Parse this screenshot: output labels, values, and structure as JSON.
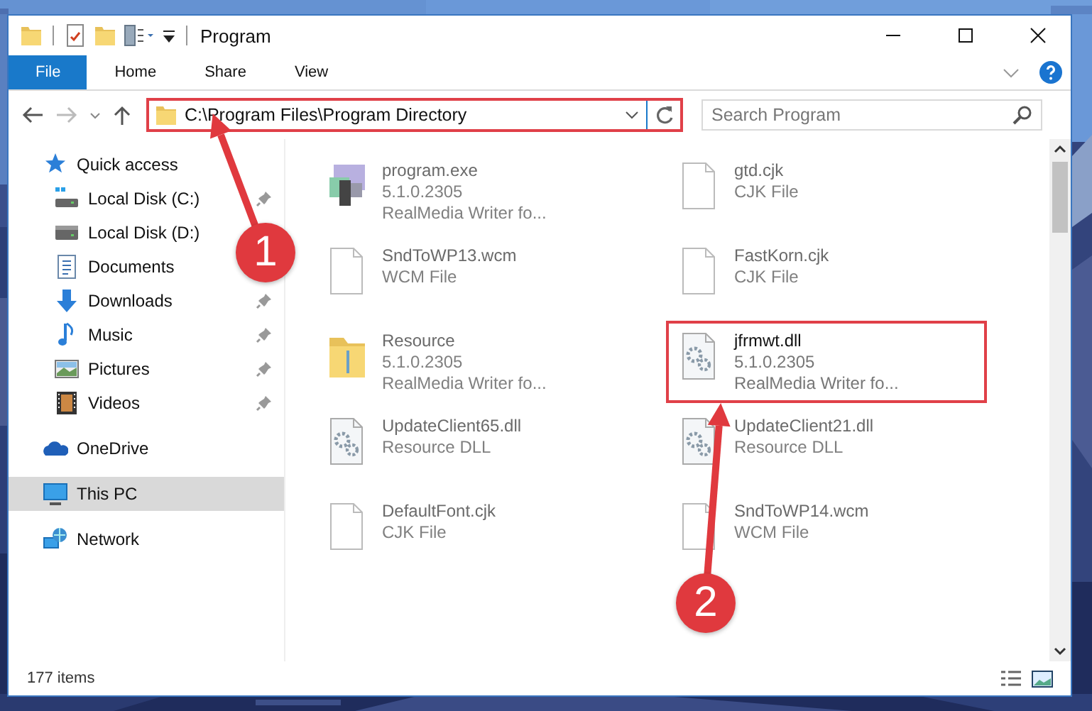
{
  "window": {
    "title": "Program"
  },
  "ribbon_tabs": [
    {
      "label": "File",
      "kind": "menu"
    },
    {
      "label": "Home",
      "kind": "tab"
    },
    {
      "label": "Share",
      "kind": "tab"
    },
    {
      "label": "View",
      "kind": "tab"
    }
  ],
  "address": {
    "path": "C:\\Program Files\\Program Directory",
    "highlighted": true
  },
  "search": {
    "placeholder": "Search Program"
  },
  "sidebar": {
    "items": [
      {
        "label": "Quick access",
        "selected": false,
        "children": [
          {
            "label": "Local Disk (C:)",
            "pinned": true,
            "selected": false
          },
          {
            "label": "Local Disk (D:)",
            "pinned": false,
            "selected": false
          },
          {
            "label": "Documents",
            "pinned": false,
            "selected": false
          },
          {
            "label": "Downloads",
            "pinned": true,
            "selected": false
          },
          {
            "label": "Music",
            "pinned": true,
            "selected": false
          },
          {
            "label": "Pictures",
            "pinned": true,
            "selected": false
          },
          {
            "label": "Videos",
            "pinned": true,
            "selected": false
          }
        ]
      },
      {
        "label": "OneDrive",
        "selected": false
      },
      {
        "label": "This PC",
        "selected": true
      },
      {
        "label": "Network",
        "selected": false
      }
    ]
  },
  "files": [
    {
      "name": "program.exe",
      "details": [
        "5.1.0.2305",
        "RealMedia Writer fo..."
      ],
      "kind": "exe",
      "highlighted": false
    },
    {
      "name": "gtd.cjk",
      "details": [
        "CJK File"
      ],
      "kind": "file",
      "highlighted": false
    },
    {
      "name": "SndToWP13.wcm",
      "details": [
        "WCM File"
      ],
      "kind": "file",
      "highlighted": false
    },
    {
      "name": "FastKorn.cjk",
      "details": [
        "CJK File"
      ],
      "kind": "file",
      "highlighted": false
    },
    {
      "name": "Resource",
      "details": [
        "5.1.0.2305",
        "RealMedia Writer fo..."
      ],
      "kind": "folder",
      "highlighted": false
    },
    {
      "name": "jfrmwt.dll",
      "details": [
        "5.1.0.2305",
        "RealMedia Writer fo..."
      ],
      "kind": "dll",
      "highlighted": true
    },
    {
      "name": "UpdateClient65.dll",
      "details": [
        "Resource DLL"
      ],
      "kind": "dll",
      "highlighted": false
    },
    {
      "name": "UpdateClient21.dll",
      "details": [
        "Resource DLL"
      ],
      "kind": "dll",
      "highlighted": false
    },
    {
      "name": "DefaultFont.cjk",
      "details": [
        "CJK File"
      ],
      "kind": "file",
      "highlighted": false
    },
    {
      "name": "SndToWP14.wcm",
      "details": [
        "WCM File"
      ],
      "kind": "file",
      "highlighted": false
    }
  ],
  "status_bar": {
    "item_count": "177 items"
  },
  "callouts": [
    {
      "number": "1"
    },
    {
      "number": "2"
    }
  ]
}
